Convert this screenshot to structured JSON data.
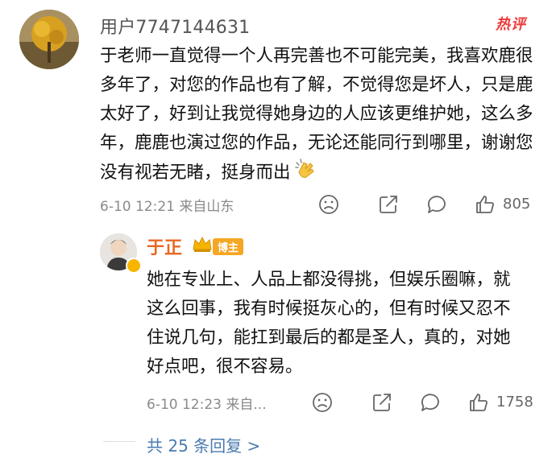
{
  "comment": {
    "username": "用户7747144631",
    "hot_label": "热评",
    "text": "于老师一直觉得一个人再完善也不可能完美，我喜欢鹿很多年了，对您的作品也有了解，不觉得您是坏人，只是鹿太好了，好到让我觉得她身边的人应该更维护她，这么多年，鹿鹿也演过您的作品，无论还能同行到哪里，谢谢您没有视若无睹，挺身而出",
    "meta": "6-10 12:21  来自山东",
    "likes": "805"
  },
  "reply": {
    "username": "于正",
    "owner_label": "博主",
    "text": "她在专业上、人品上都没得挑，但娱乐圈嘛，就这么回事，我有时候挺灰心的，但有时候又忍不住说几句，能扛到最后的都是圣人，真的，对她好点吧，很不容易。",
    "meta": "6-10 12:23  来自...",
    "likes": "1758"
  },
  "more_replies": "共 25 条回复 >",
  "colors": {
    "hot": "#ee3b3b",
    "reply_name": "#e86722",
    "owner_tag": "#f5a623",
    "link": "#4a7ab0",
    "meta": "#8a8a8a"
  }
}
